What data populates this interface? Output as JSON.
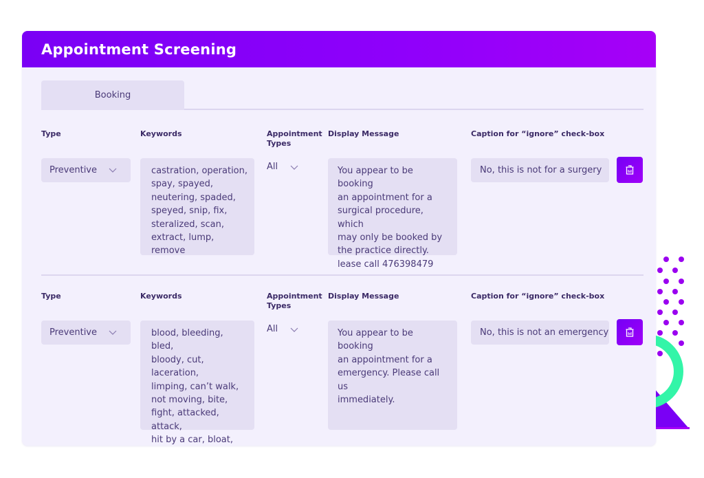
{
  "header": {
    "title": "Appointment Screening"
  },
  "tabs": [
    {
      "label": "Booking",
      "active": true
    }
  ],
  "columns": {
    "type": "Type",
    "keywords": "Keywords",
    "appointment_types": "Appointment\nTypes",
    "display_message": "Display Message",
    "caption": "Caption for “ignore” check-box"
  },
  "rules": [
    {
      "type": "Preventive",
      "keywords": "castration, operation,\nspay, spayed,\nneutering, spaded,\nspeyed, snip, fix,\nsteralized, scan,\nextract, lump, remove",
      "appointment_types": "All",
      "display_message": "You appear to be booking\nan appointment for a\nsurgical procedure, which\nmay only be booked by\nthe practice directly.\nlease call 476398479",
      "caption": "No, this is not for a surgery",
      "delete_icon": "trash-icon"
    },
    {
      "type": "Preventive",
      "keywords": "blood, bleeding, bled,\nbloody, cut, laceration,\nlimping, can’t walk,\nnot moving, bite,\nfight, attacked, attack,\nhit by a car, bloat,\ncrying",
      "appointment_types": "All",
      "display_message": "You appear to be booking\nan appointment for a\nemergency. Please call us\nimmediately.",
      "caption": "No, this is not an emergency",
      "delete_icon": "trash-icon"
    }
  ],
  "colors": {
    "accent": "#8000f7",
    "accent_end": "#a600f7",
    "panel_bg": "#f3f0fd",
    "field_bg": "#e4dff3",
    "text": "#4a3a78",
    "decor_green": "#33f5a8"
  }
}
